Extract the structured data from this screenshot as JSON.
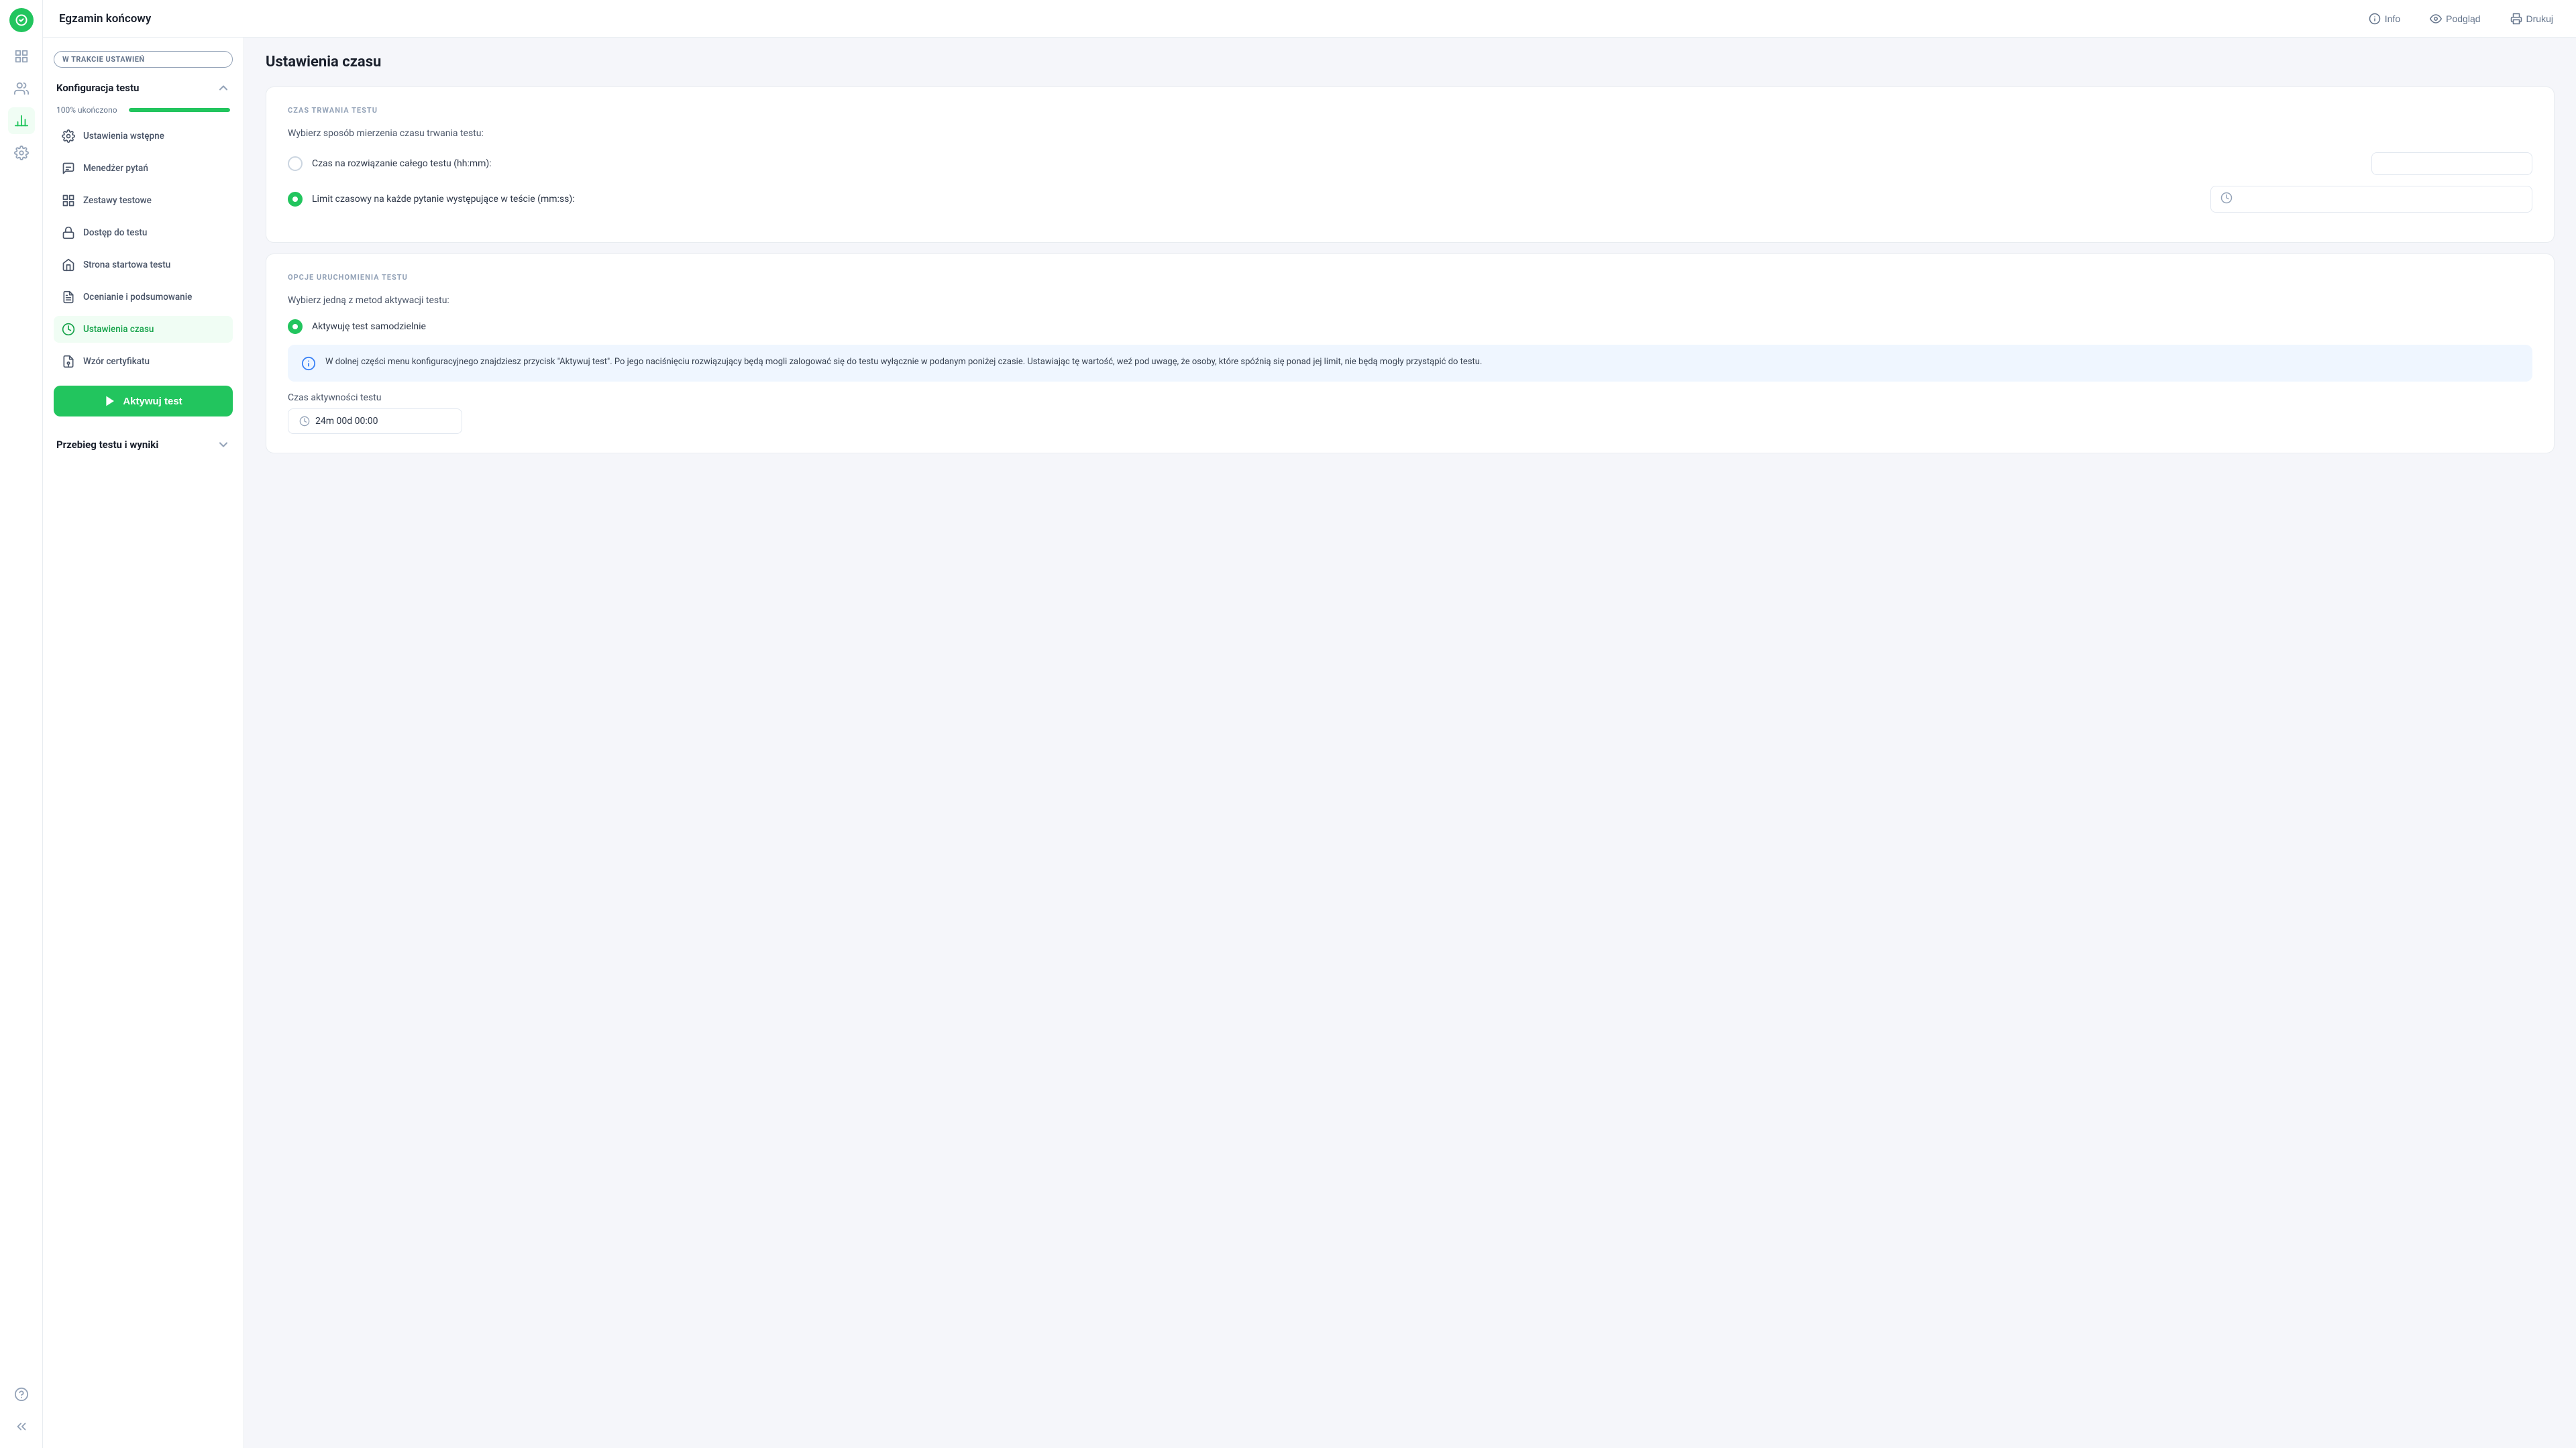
{
  "app": {
    "logo_alt": "TestPortal logo"
  },
  "header": {
    "title": "Egzamin końcowy",
    "actions": {
      "info_label": "Info",
      "preview_label": "Podgląd",
      "print_label": "Drukuj"
    }
  },
  "left_panel": {
    "status_badge": "W TRAKCIE USTAWIEŃ",
    "config_section": {
      "title": "Konfiguracja testu",
      "progress_label": "100% ukończono",
      "progress_value": 100
    },
    "nav_items": [
      {
        "id": "ustawienia-wstepne",
        "label": "Ustawienia wstępne",
        "icon": "settings-icon",
        "active": false
      },
      {
        "id": "menedzer-pytan",
        "label": "Menedżer pytań",
        "icon": "questions-icon",
        "active": false
      },
      {
        "id": "zestawy-testowe",
        "label": "Zestawy testowe",
        "icon": "sets-icon",
        "active": false
      },
      {
        "id": "dostep-do-testu",
        "label": "Dostęp do testu",
        "icon": "lock-icon",
        "active": false
      },
      {
        "id": "strona-startowa",
        "label": "Strona startowa testu",
        "icon": "home-icon",
        "active": false
      },
      {
        "id": "ocenianie",
        "label": "Ocenianie i podsumowanie",
        "icon": "grade-icon",
        "active": false
      },
      {
        "id": "ustawienia-czasu",
        "label": "Ustawienia czasu",
        "icon": "clock-icon",
        "active": true
      },
      {
        "id": "wzor-certyfikatu",
        "label": "Wzór certyfikatu",
        "icon": "certificate-icon",
        "active": false
      }
    ],
    "activate_btn_label": "Aktywuj test",
    "results_section": {
      "title": "Przebieg testu i wyniki"
    }
  },
  "main": {
    "title": "Ustawienia czasu",
    "czas_trwania": {
      "section_label": "CZAS TRWANIA TESTU",
      "description": "Wybierz sposób mierzenia czasu trwania testu:",
      "option1_label": "Czas na rozwiązanie całego testu (hh:mm):",
      "option1_selected": false,
      "option1_value": "",
      "option2_label": "Limit czasowy na każde pytanie występujące w teście (mm:ss):",
      "option2_selected": true,
      "option2_value": ""
    },
    "opcje_uruchomienia": {
      "section_label": "OPCJE URUCHOMIENIA TESTU",
      "description": "Wybierz jedną z metod aktywacji testu:",
      "option1_label": "Aktywuję test samodzielnie",
      "option1_selected": true,
      "info_text": "W dolnej części menu konfiguracyjnego znajdziesz przycisk \"Aktywuj test\". Po jego naciśnięciu rozwiązujący będą mogli zalogować się do testu wyłącznie w podanym poniżej czasie. Ustawiając tę wartość, weź pod uwagę, że osoby, które spóźnią się ponad jej limit, nie będą mogły przystąpić do testu.",
      "czas_aktywnosci_label": "Czas aktywności testu",
      "czas_aktywnosci_value": "24m 00d 00:00"
    }
  },
  "icons": {
    "info": "ℹ",
    "eye": "👁",
    "print": "🖨",
    "clock": "🕐"
  }
}
